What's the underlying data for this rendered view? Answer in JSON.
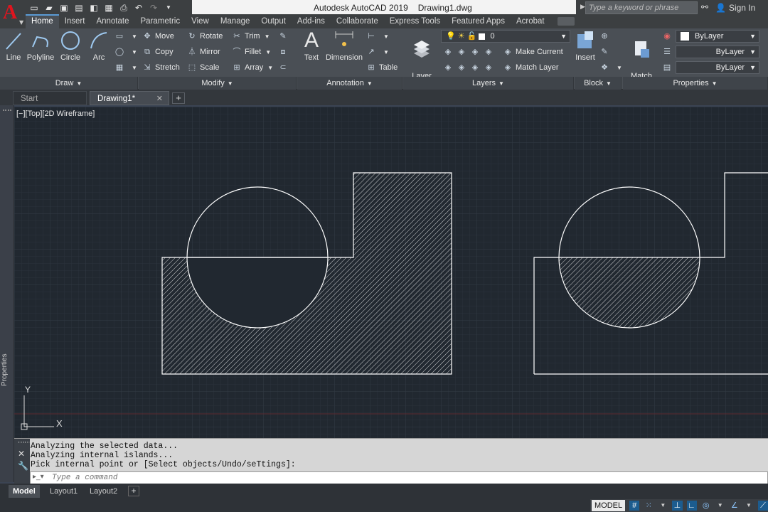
{
  "app": {
    "logo_letter": "A",
    "title": "Autodesk AutoCAD 2019",
    "document": "Drawing1.dwg",
    "search_placeholder": "Type a keyword or phrase",
    "sign_in": "Sign In"
  },
  "ribbon_tabs": [
    "Home",
    "Insert",
    "Annotate",
    "Parametric",
    "View",
    "Manage",
    "Output",
    "Add-ins",
    "Collaborate",
    "Express Tools",
    "Featured Apps",
    "Acrobat"
  ],
  "panels": {
    "draw": {
      "title": "Draw",
      "tools": [
        "Line",
        "Polyline",
        "Circle",
        "Arc"
      ]
    },
    "modify": {
      "title": "Modify",
      "tools": [
        "Move",
        "Rotate",
        "Trim",
        "Copy",
        "Mirror",
        "Fillet",
        "Stretch",
        "Scale",
        "Array"
      ]
    },
    "annotation": {
      "title": "Annotation",
      "tools": [
        "Text",
        "Dimension",
        "Table"
      ]
    },
    "layers": {
      "title": "Layers",
      "layer_properties": "Layer\nProperties",
      "current_layer": "0",
      "make_current": "Make Current",
      "match_layer": "Match Layer"
    },
    "block": {
      "title": "Block",
      "insert": "Insert"
    },
    "properties": {
      "title": "Properties",
      "match_properties": "Match\nProperties",
      "color": "ByLayer",
      "linetype": "ByLayer",
      "lineweight": "ByLayer"
    }
  },
  "doc_tabs": {
    "start": "Start",
    "drawing": "Drawing1*"
  },
  "viewport": {
    "label": "[−][Top][2D Wireframe]",
    "axis_x": "X",
    "axis_y": "Y"
  },
  "side_palette": "Properties",
  "command": {
    "history": [
      "Analyzing the selected data...",
      "Analyzing internal islands...",
      "Pick internal point or [Select objects/Undo/seTtings]:"
    ],
    "placeholder": "Type a command"
  },
  "layout_tabs": [
    "Model",
    "Layout1",
    "Layout2"
  ],
  "status": {
    "mode": "MODEL"
  },
  "colors": {
    "viewport_bg": "#212830",
    "geometry": "#ffffff",
    "accent": "#5a9bd5"
  }
}
